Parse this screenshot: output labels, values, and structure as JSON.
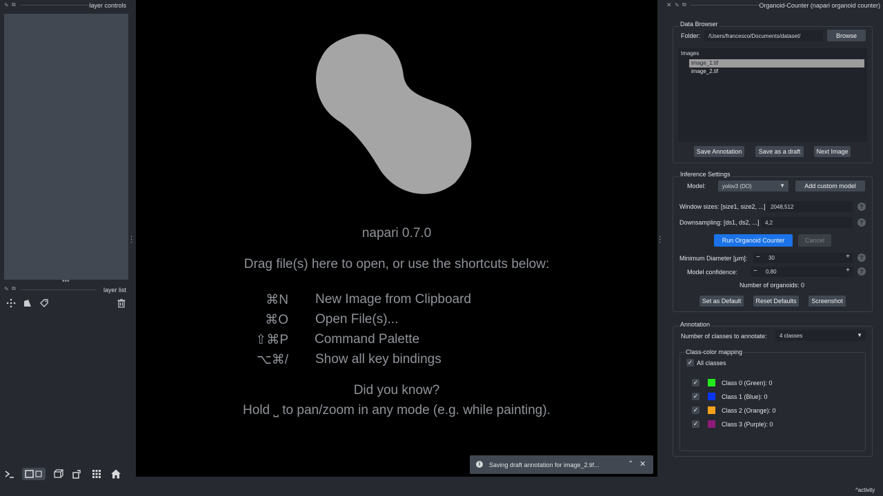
{
  "layer_controls": {
    "title": "layer controls"
  },
  "layer_list": {
    "title": "layer list"
  },
  "welcome": {
    "version": "napari 0.7.0",
    "drag_hint": "Drag file(s) here to open, or use the shortcuts below:",
    "shortcuts": [
      {
        "key": "⌘N",
        "label": "New Image from Clipboard"
      },
      {
        "key": "⌘O",
        "label": "Open File(s)..."
      },
      {
        "key": "⇧⌘P",
        "label": "Command Palette"
      },
      {
        "key": "⌥⌘/",
        "label": "Show all key bindings"
      }
    ],
    "did_you_know": "Did you know?",
    "tip": "Hold ⎵ to pan/zoom in any mode (e.g. while painting)."
  },
  "plugin": {
    "title": "Organoid-Counter (napari organoid counter)",
    "data_browser": {
      "title": "Data Browser",
      "folder_label": "Folder:",
      "folder_value": "/Users/francesco/Documents/dataset/",
      "browse_label": "Browse",
      "images_label": "Images",
      "images": [
        "image_1.tif",
        "image_2.tif"
      ],
      "save_annotation": "Save Annotation",
      "save_draft": "Save as a draft",
      "next_image": "Next Image"
    },
    "inference": {
      "title": "Inference Settings",
      "model_label": "Model:",
      "model_value": "yolov3 (DO)",
      "add_model": "Add custom model",
      "window_label": "Window sizes: [size1, size2, ...]",
      "window_value": "2048,512",
      "downsampling_label": "Downsampling: [ds1, ds2, ...]",
      "downsampling_value": "4,2",
      "run": "Run Organoid Counter",
      "cancel": "Cancel",
      "min_diam_label": "Minimum Diameter [µm]:",
      "min_diam_value": "30",
      "confidence_label": "Model confidence:",
      "confidence_value": "0,80",
      "count_text": "Number of organoids: 0",
      "set_default": "Set as Default",
      "reset_defaults": "Reset Defaults",
      "screenshot": "Screenshot"
    },
    "annotation": {
      "title": "Annotation",
      "num_classes_label": "Number of classes to annotate:",
      "num_classes_value": "4 classes",
      "mapping_title": "Class-color mapping",
      "all_classes": "All classes",
      "classes": [
        {
          "label": "Class 0 (Green): 0",
          "color": "#22e81c"
        },
        {
          "label": "Class 1 (Blue): 0",
          "color": "#0a36f0"
        },
        {
          "label": "Class 2 (Orange): 0",
          "color": "#f7a11d"
        },
        {
          "label": "Class 3 (Purple): 0",
          "color": "#8b1a7a"
        }
      ]
    }
  },
  "notification": {
    "text": "Saving draft annotation for image_2.tif..."
  },
  "activity": {
    "label": "activity"
  },
  "colors": {
    "bg": "#262930",
    "canvas": "#000000",
    "accent": "#1a73e8",
    "shape": "#a5a5a5"
  }
}
